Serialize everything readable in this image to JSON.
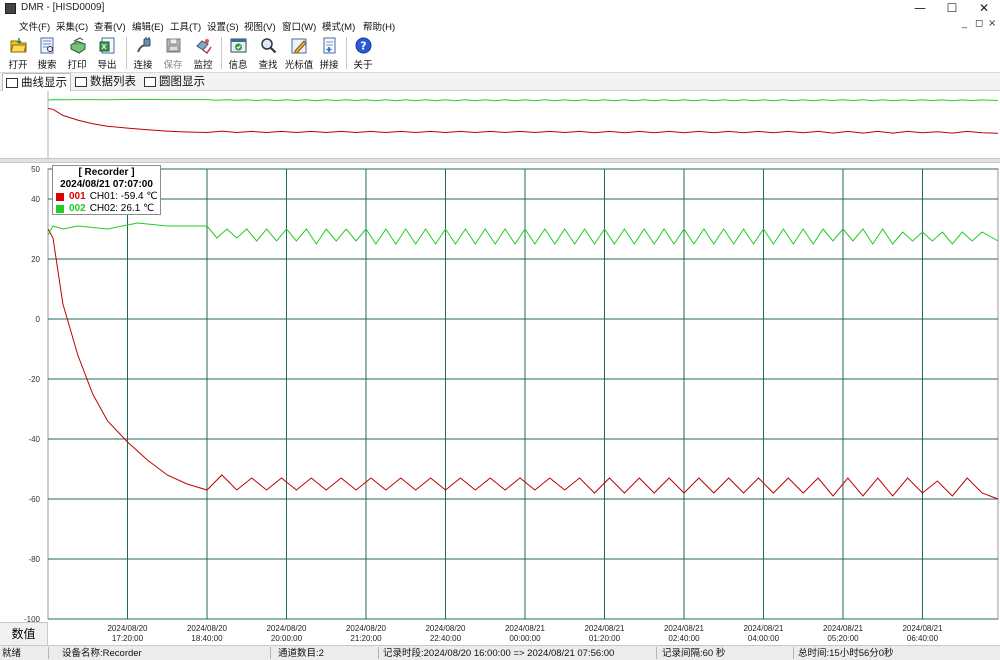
{
  "window": {
    "title": "DMR - [HISD0009]",
    "controls": [
      "—",
      "☐",
      "✕"
    ],
    "mdi_controls": [
      "_",
      "◻",
      "×"
    ]
  },
  "menu": [
    "文件(F)",
    "采集(C)",
    "查看(V)",
    "编辑(E)",
    "工具(T)",
    "设置(S)",
    "视图(V)",
    "窗口(W)",
    "模式(M)",
    "帮助(H)"
  ],
  "toolbar": [
    {
      "label": "打开",
      "icon": "open-folder-icon"
    },
    {
      "label": "搜索",
      "icon": "search-document-icon"
    },
    {
      "label": "打印",
      "icon": "printer-icon"
    },
    {
      "label": "导出",
      "icon": "export-icon"
    },
    {
      "label": "连接",
      "icon": "connect-plug-icon"
    },
    {
      "label": "保存",
      "icon": "save-disk-icon",
      "disabled": true
    },
    {
      "label": "监控",
      "icon": "monitor-icon"
    },
    {
      "label": "信息",
      "icon": "info-window-icon"
    },
    {
      "label": "查找",
      "icon": "magnifier-icon"
    },
    {
      "label": "光标值",
      "icon": "cursor-pencil-icon"
    },
    {
      "label": "拼接",
      "icon": "merge-document-icon"
    },
    {
      "label": "关于",
      "icon": "help-question-icon"
    }
  ],
  "tabs": [
    {
      "label": "曲线显示",
      "active": true
    },
    {
      "label": "数据列表",
      "active": false
    },
    {
      "label": "圆图显示",
      "active": false
    }
  ],
  "tooltip": {
    "title": "[ Recorder ]",
    "time": "2024/08/21 07:07:00",
    "rows": [
      {
        "id": "001",
        "text": "CH01: -59.4 ℃",
        "color": "#e00000"
      },
      {
        "id": "002",
        "text": "CH02: 26.1 ℃",
        "color": "#00cc00"
      }
    ]
  },
  "num_label": "数值",
  "colors": {
    "ch01": "#c00000",
    "ch02": "#22cc22",
    "grid": "#1e6b5e"
  },
  "chart_data": {
    "type": "line",
    "ylim": [
      -100,
      50
    ],
    "yticks": [
      50,
      40,
      20,
      0,
      -20,
      -40,
      -60,
      -80,
      -100
    ],
    "grid": true,
    "xticks": [
      {
        "date": "2024/08/20",
        "time": "17:20:00"
      },
      {
        "date": "2024/08/20",
        "time": "18:40:00"
      },
      {
        "date": "2024/08/20",
        "time": "20:00:00"
      },
      {
        "date": "2024/08/20",
        "time": "21:20:00"
      },
      {
        "date": "2024/08/20",
        "time": "22:40:00"
      },
      {
        "date": "2024/08/21",
        "time": "00:00:00"
      },
      {
        "date": "2024/08/21",
        "time": "01:20:00"
      },
      {
        "date": "2024/08/21",
        "time": "02:40:00"
      },
      {
        "date": "2024/08/21",
        "time": "04:00:00"
      },
      {
        "date": "2024/08/21",
        "time": "05:20:00"
      },
      {
        "date": "2024/08/21",
        "time": "06:40:00"
      }
    ],
    "x_range": [
      "2024/08/20 16:00:00",
      "2024/08/21 07:56:00"
    ],
    "series": [
      {
        "name": "CH01",
        "x": [
          "16:00",
          "16:05",
          "16:15",
          "16:30",
          "16:45",
          "17:00",
          "17:20",
          "17:40",
          "18:00",
          "18:20",
          "18:40",
          "18:55",
          "19:10",
          "19:25",
          "19:40",
          "19:55",
          "20:10",
          "20:25",
          "20:40",
          "20:55",
          "21:10",
          "21:25",
          "21:40",
          "21:55",
          "22:10",
          "22:25",
          "22:40",
          "22:55",
          "23:10",
          "23:25",
          "23:40",
          "23:55",
          "00:10",
          "00:25",
          "00:40",
          "00:55",
          "01:10",
          "01:25",
          "01:40",
          "01:55",
          "02:10",
          "02:25",
          "02:40",
          "02:55",
          "03:10",
          "03:25",
          "03:40",
          "03:55",
          "04:10",
          "04:25",
          "04:40",
          "04:55",
          "05:10",
          "05:25",
          "05:40",
          "05:55",
          "06:10",
          "06:25",
          "06:40",
          "06:55",
          "07:10",
          "07:25",
          "07:40",
          "07:56"
        ],
        "values": [
          30,
          27,
          5,
          -12,
          -25,
          -34,
          -41,
          -47,
          -52,
          -55,
          -57,
          -52,
          -57,
          -53,
          -57,
          -53,
          -57,
          -53,
          -57,
          -53,
          -57,
          -53,
          -57,
          -53,
          -57,
          -53,
          -57,
          -53,
          -57,
          -53,
          -57,
          -53,
          -57,
          -53,
          -57,
          -53,
          -58,
          -53,
          -58,
          -53,
          -58,
          -53,
          -58,
          -53,
          -58,
          -53,
          -58,
          -53,
          -58,
          -53,
          -58,
          -53,
          -59,
          -53,
          -59,
          -53,
          -59,
          -53,
          -58,
          -54,
          -59,
          -53,
          -58,
          -60
        ]
      },
      {
        "name": "CH02",
        "x": [
          "16:00",
          "16:05",
          "16:15",
          "16:30",
          "17:00",
          "17:30",
          "18:00",
          "18:30",
          "18:40",
          "18:50",
          "19:00",
          "19:10",
          "19:20",
          "19:30",
          "19:40",
          "19:50",
          "20:00",
          "20:10",
          "20:20",
          "20:30",
          "20:40",
          "20:50",
          "21:00",
          "21:10",
          "21:20",
          "21:30",
          "21:40",
          "21:50",
          "22:00",
          "22:10",
          "22:20",
          "22:30",
          "22:40",
          "22:50",
          "23:00",
          "23:10",
          "23:20",
          "23:30",
          "23:40",
          "23:50",
          "00:00",
          "00:10",
          "00:20",
          "00:30",
          "00:40",
          "00:50",
          "01:00",
          "01:10",
          "01:20",
          "01:30",
          "01:40",
          "01:50",
          "02:00",
          "02:10",
          "02:20",
          "02:30",
          "02:40",
          "02:50",
          "03:00",
          "03:10",
          "03:20",
          "03:30",
          "03:40",
          "03:50",
          "04:00",
          "04:10",
          "04:20",
          "04:30",
          "04:40",
          "04:50",
          "05:00",
          "05:10",
          "05:20",
          "05:30",
          "05:40",
          "05:50",
          "06:00",
          "06:10",
          "06:20",
          "06:30",
          "06:40",
          "06:50",
          "07:00",
          "07:10",
          "07:20",
          "07:30",
          "07:40",
          "07:56"
        ],
        "values": [
          28,
          31,
          30,
          31,
          30,
          32,
          31,
          31,
          31,
          27,
          30,
          27,
          30,
          26,
          30,
          26,
          30,
          26,
          30,
          25,
          30,
          26,
          30,
          26,
          30,
          25,
          30,
          25,
          30,
          25,
          30,
          25,
          30,
          25,
          30,
          25,
          30,
          25,
          30,
          25,
          30,
          25,
          30,
          25,
          30,
          25,
          30,
          25,
          30,
          25,
          30,
          25,
          30,
          25,
          30,
          25,
          30,
          25,
          30,
          25,
          30,
          25,
          30,
          25,
          30,
          25,
          30,
          25,
          30,
          25,
          30,
          26,
          30,
          26,
          30,
          25,
          30,
          25,
          29,
          26,
          29,
          26,
          29,
          25,
          29,
          26,
          29,
          26
        ]
      }
    ]
  },
  "status": {
    "ready": "就绪",
    "device": "设备名称:Recorder",
    "channels": "通道数目:2",
    "period": "记录时段:2024/08/20 16:00:00 => 2024/08/21 07:56:00",
    "interval": "记录间隔:60 秒",
    "total": "总时间:15小时56分0秒"
  }
}
